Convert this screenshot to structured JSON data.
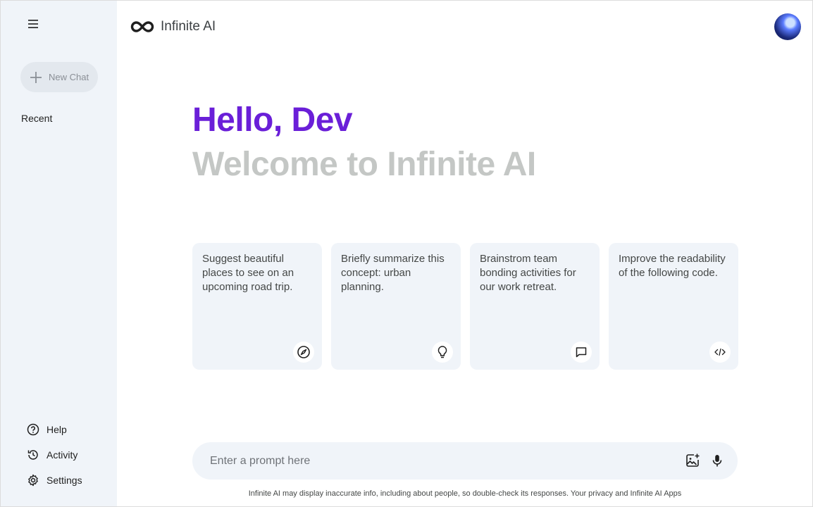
{
  "app": {
    "name": "Infinite AI"
  },
  "sidebar": {
    "new_chat_label": "New Chat",
    "recent_title": "Recent",
    "bottom_items": [
      {
        "label": "Help",
        "icon": "help-circle-icon"
      },
      {
        "label": "Activity",
        "icon": "history-icon"
      },
      {
        "label": "Settings",
        "icon": "gear-icon"
      }
    ]
  },
  "greeting": {
    "hello": "Hello, Dev",
    "welcome": "Welcome to Infinite AI"
  },
  "cards": [
    {
      "text": "Suggest beautiful places to see on an upcoming road trip.",
      "icon": "compass-icon"
    },
    {
      "text": "Briefly summarize this concept: urban planning.",
      "icon": "lightbulb-icon"
    },
    {
      "text": "Brainstrom team bonding activities for our work retreat.",
      "icon": "chat-bubble-icon"
    },
    {
      "text": "Improve the readability of the following code.",
      "icon": "code-icon"
    }
  ],
  "prompt": {
    "placeholder": "Enter a prompt here"
  },
  "disclaimer": "Infinite AI may display inaccurate info, including about people, so double-check its responses. Your privacy and Infinite AI Apps",
  "colors": {
    "accent": "#6a1fd8",
    "muted_heading": "#c4c7c5",
    "sidebar_bg": "#f0f4f9",
    "card_bg": "#f0f4f9"
  }
}
